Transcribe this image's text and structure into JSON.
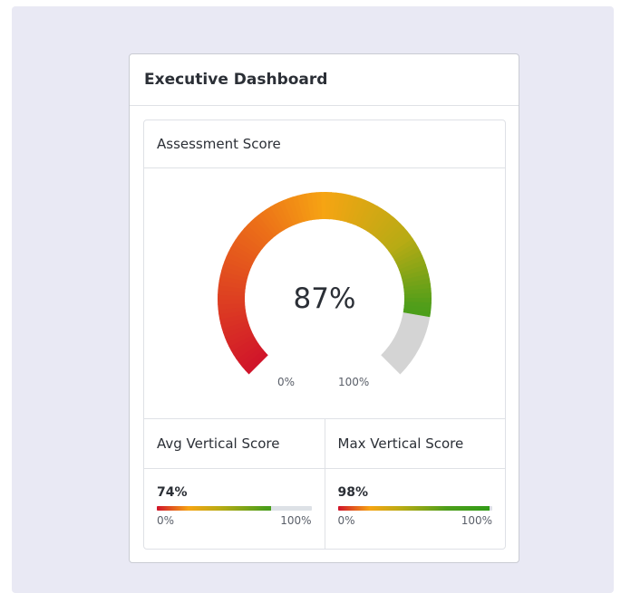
{
  "dashboard": {
    "title": "Executive Dashboard"
  },
  "assessment": {
    "title": "Assessment Score",
    "value_label": "87%",
    "value": 87,
    "min_label": "0%",
    "max_label": "100%"
  },
  "avg_vertical": {
    "title": "Avg Vertical Score",
    "value_label": "74%",
    "value": 74,
    "min_label": "0%",
    "max_label": "100%"
  },
  "max_vertical": {
    "title": "Max Vertical Score",
    "value_label": "98%",
    "value": 98,
    "min_label": "0%",
    "max_label": "100%"
  },
  "colors": {
    "low": "#d0132a",
    "mid": "#f6a413",
    "high": "#2f9c17",
    "track": "#d4d4d4",
    "background": "#e9e9f4"
  }
}
